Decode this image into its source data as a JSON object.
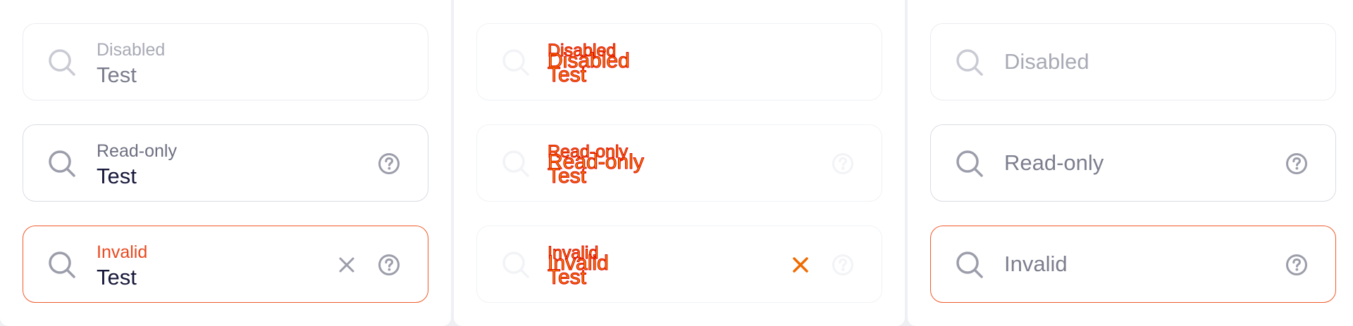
{
  "columns": [
    {
      "fields": [
        {
          "state": "disabled",
          "label": "Disabled",
          "value": "Test"
        },
        {
          "state": "readonly",
          "label": "Read-only",
          "value": "Test"
        },
        {
          "state": "invalid",
          "label": "Invalid",
          "value": "Test"
        }
      ]
    },
    {
      "fields": [
        {
          "state": "disabled",
          "label": "Disabled",
          "overlay": "Disabled",
          "value": "Test"
        },
        {
          "state": "readonly",
          "label": "Read-only",
          "overlay": "Read-only",
          "value": "Test"
        },
        {
          "state": "invalid",
          "label": "Invalid",
          "overlay": "Invalid",
          "value": "Test"
        }
      ]
    },
    {
      "fields": [
        {
          "state": "disabled",
          "placeholder": "Disabled"
        },
        {
          "state": "readonly",
          "placeholder": "Read-only"
        },
        {
          "state": "invalid",
          "placeholder": "Invalid"
        }
      ]
    }
  ],
  "icons": {
    "search": "search-icon",
    "help": "help-circle-icon",
    "clear": "close-icon"
  },
  "colors": {
    "invalid": "#ef5a2a",
    "text": "#16173a",
    "muted": "#7c7e8e",
    "border": "#dadce3"
  }
}
